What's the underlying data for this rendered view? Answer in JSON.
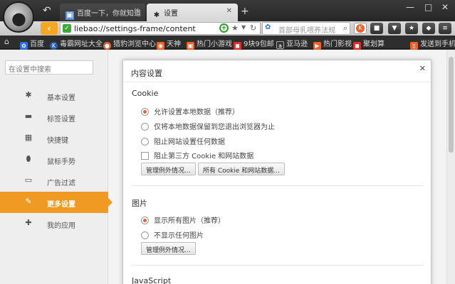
{
  "tabs": [
    {
      "label": "百度一下，你就知道",
      "icon": "page-icon"
    },
    {
      "label": "设置",
      "icon": "gear-icon"
    }
  ],
  "window_controls": [
    "—",
    "□",
    "✕"
  ],
  "address": {
    "url": "liebao://settings-frame/content",
    "search_query": "首部母乳喂养法规"
  },
  "bookmarks": [
    {
      "label": "百度",
      "color": "#2f6fd6"
    },
    {
      "label": "毒霸网址大全",
      "color": "#2a5db0"
    },
    {
      "label": "猎豹浏览中心",
      "color": "#e8622a"
    },
    {
      "label": "天神",
      "color": "#e8622a"
    },
    {
      "label": "热门小游戏",
      "color": "#e8622a"
    },
    {
      "label": "9块9包邮",
      "color": "#d9302c"
    },
    {
      "label": "亚马逊",
      "color": "#333333"
    },
    {
      "label": "热门影视",
      "color": "#e8622a"
    },
    {
      "label": "聚划算",
      "color": "#d9302c"
    },
    {
      "label": "发送到手机",
      "color": "#e8622a"
    }
  ],
  "sidebar": {
    "search_placeholder": "在设置中搜索",
    "items": [
      {
        "label": "基本设置",
        "icon": "gear-icon",
        "active": false
      },
      {
        "label": "标签设置",
        "icon": "laptop-icon",
        "active": false
      },
      {
        "label": "快捷键",
        "icon": "keyboard-icon",
        "active": false
      },
      {
        "label": "鼠标手势",
        "icon": "mouse-icon",
        "active": false
      },
      {
        "label": "广告过滤",
        "icon": "window-icon",
        "active": false
      },
      {
        "label": "更多设置",
        "icon": "wrench-icon",
        "active": true
      },
      {
        "label": "我的应用",
        "icon": "puzzle-icon",
        "active": false
      }
    ]
  },
  "dialog": {
    "title": "内容设置",
    "cookie": {
      "title": "Cookie",
      "options": [
        "允许设置本地数据（推荐）",
        "仅将本地数据保留到您退出浏览器为止",
        "阻止网站设置任何数据"
      ],
      "checkbox": "阻止第三方 Cookie 和网站数据",
      "btn_exceptions": "管理例外情况...",
      "btn_all": "所有 Cookie 和网站数据..."
    },
    "images": {
      "title": "图片",
      "options": [
        "显示所有图片（推荐）",
        "不显示任何图片"
      ],
      "btn_exceptions": "管理例外情况..."
    },
    "javascript": {
      "title": "JavaScript"
    }
  },
  "colors": {
    "accent": "#f09a23",
    "radio_selected": "#e8622a"
  }
}
